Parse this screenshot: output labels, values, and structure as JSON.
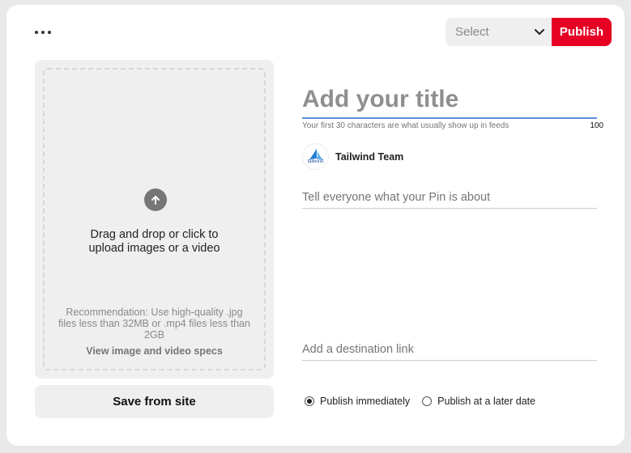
{
  "header": {
    "more_icon": "more-horizontal-icon",
    "select": {
      "value": "Select",
      "icon": "chevron-down-icon"
    },
    "publish_label": "Publish",
    "accent_color": "#e60023"
  },
  "upload": {
    "icon": "upload-arrow-icon",
    "prompt": "Drag and drop or click to\nupload images or a video",
    "recommendation": "Recommendation: Use high-quality .jpg files less than 32MB or .mp4 files less than 2GB",
    "specs_link": "View image and video specs",
    "save_from_site": "Save from site"
  },
  "form": {
    "title_placeholder": "Add your title",
    "title_hint": "Your first 30 characters are what usually show up in feeds",
    "title_remaining": "100",
    "account": {
      "name": "Tailwind Team",
      "avatar_label": "tailwind"
    },
    "description_placeholder": "Tell everyone what your Pin is about",
    "link_placeholder": "Add a destination link",
    "publish_options": [
      {
        "label": "Publish immediately",
        "checked": true
      },
      {
        "label": "Publish at a later date",
        "checked": false
      }
    ]
  }
}
